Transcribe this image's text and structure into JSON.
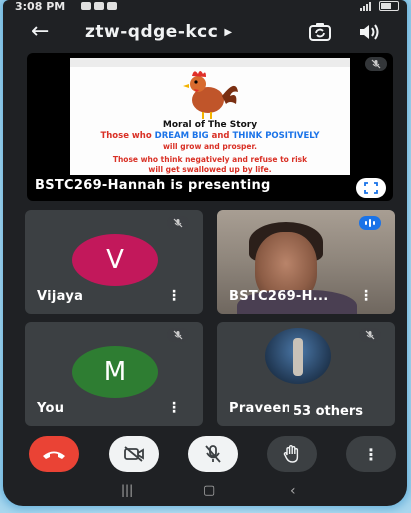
{
  "status_bar": {
    "time": "3:08 PM"
  },
  "header": {
    "meeting_code": "ztw-qdge-kcc",
    "back_icon": "arrow-left-icon",
    "caret_icon": "caret-right-icon"
  },
  "presentation": {
    "slide": {
      "title": "Moral of The Story",
      "line1_part1": "Those who ",
      "line1_highlight1": "DREAM BIG",
      "line1_part2": " and ",
      "line1_highlight2": "THINK POSITIVELY",
      "line2": "will grow and prosper.",
      "line3": "Those who think negatively and refuse to risk",
      "line4": "will get swallowed up by life."
    },
    "presenter_label": "BSTC269-Hannah is presenting"
  },
  "participants": [
    {
      "name": "Vijaya",
      "initial": "V",
      "avatar_color": "#c2185b",
      "muted": true
    },
    {
      "name": "BSTC269-H...",
      "video": true,
      "speaking": true
    },
    {
      "name": "You",
      "initial": "M",
      "avatar_color": "#2e7d32",
      "muted": true
    },
    {
      "name": "Praveen",
      "others_label": "53 others",
      "muted": true
    }
  ],
  "controls": {
    "end_call_color": "#ea4335",
    "end_call_icon": "phone-hangup-icon",
    "camera_icon": "camera-off-icon",
    "mic_icon": "mic-off-icon",
    "hand_icon": "raise-hand-icon",
    "more_icon": "more-vert-icon"
  }
}
